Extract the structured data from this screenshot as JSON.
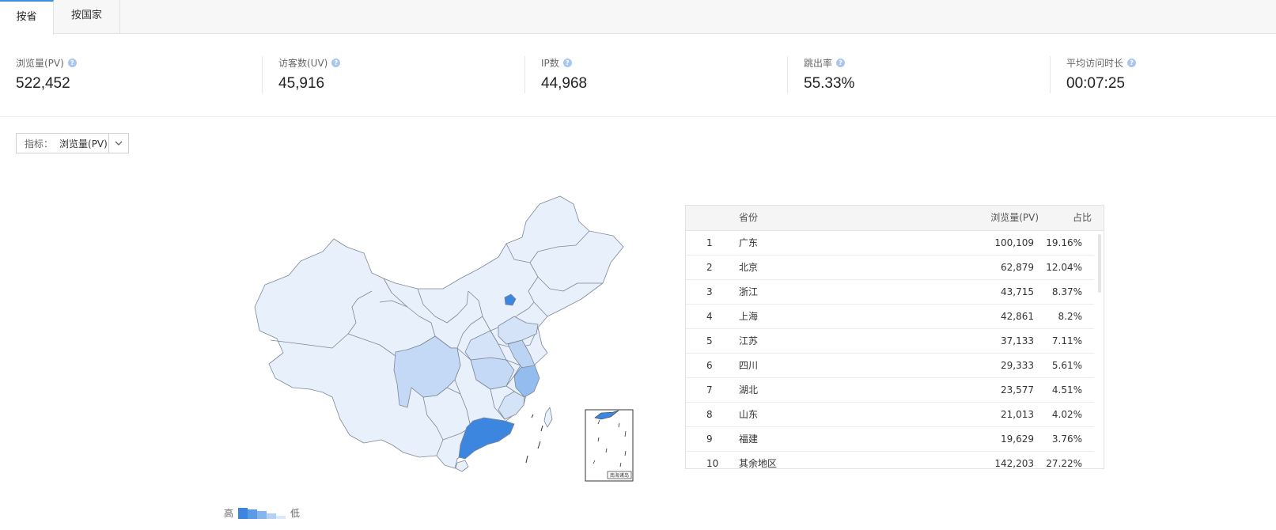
{
  "tabs": [
    {
      "label": "按省",
      "active": true
    },
    {
      "label": "按国家",
      "active": false
    }
  ],
  "kpis": [
    {
      "label": "浏览量(PV)",
      "value": "522,452"
    },
    {
      "label": "访客数(UV)",
      "value": "45,916"
    },
    {
      "label": "IP数",
      "value": "44,968"
    },
    {
      "label": "跳出率",
      "value": "55.33%"
    },
    {
      "label": "平均访问时长",
      "value": "00:07:25"
    }
  ],
  "help_glyph": "?",
  "selector": {
    "prefix": "指标：",
    "value": "浏览量(PV)"
  },
  "legend": {
    "high": "高",
    "low": "低"
  },
  "table": {
    "headers": {
      "province": "省份",
      "pv": "浏览量(PV)",
      "share": "占比"
    },
    "rows": [
      {
        "rank": "1",
        "province": "广东",
        "pv": "100,109",
        "share": "19.16%"
      },
      {
        "rank": "2",
        "province": "北京",
        "pv": "62,879",
        "share": "12.04%"
      },
      {
        "rank": "3",
        "province": "浙江",
        "pv": "43,715",
        "share": "8.37%"
      },
      {
        "rank": "4",
        "province": "上海",
        "pv": "42,861",
        "share": "8.2%"
      },
      {
        "rank": "5",
        "province": "江苏",
        "pv": "37,133",
        "share": "7.11%"
      },
      {
        "rank": "6",
        "province": "四川",
        "pv": "29,333",
        "share": "5.61%"
      },
      {
        "rank": "7",
        "province": "湖北",
        "pv": "23,577",
        "share": "4.51%"
      },
      {
        "rank": "8",
        "province": "山东",
        "pv": "21,013",
        "share": "4.02%"
      },
      {
        "rank": "9",
        "province": "福建",
        "pv": "19,629",
        "share": "3.76%"
      },
      {
        "rank": "10",
        "province": "其余地区",
        "pv": "142,203",
        "share": "27.22%"
      }
    ]
  },
  "inset_label": "南海诸岛",
  "colors": {
    "accent": "#3a8ee6",
    "map_high": "#3d86e0",
    "map_mid": "#94bcef",
    "map_low": "#c4d9f5",
    "map_base": "#e8f0fb",
    "map_stroke": "#7d8794"
  },
  "icons": {
    "help": "question-circle-icon",
    "dropdown": "chevron-down-icon"
  }
}
